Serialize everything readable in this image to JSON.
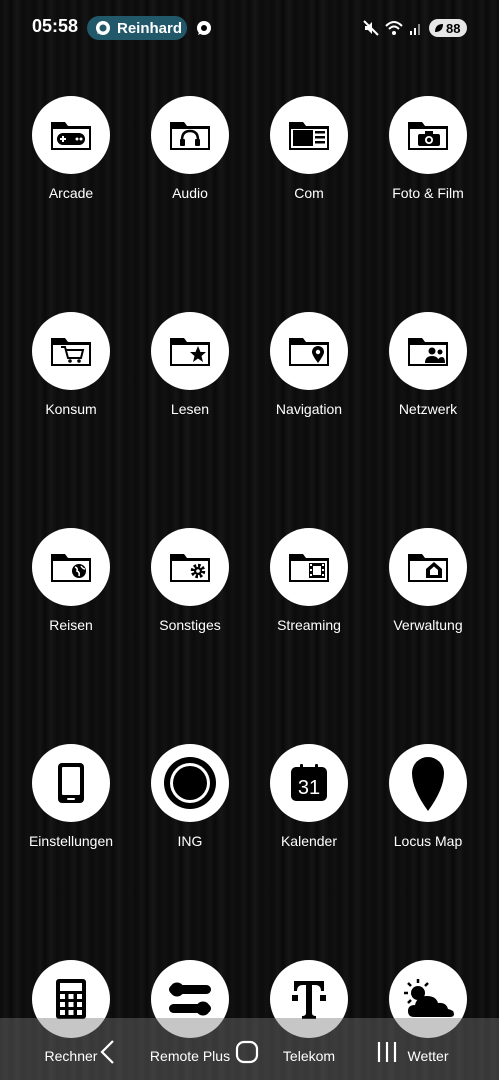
{
  "status_bar": {
    "time": "05:58",
    "chip_label": "Reinhard",
    "battery": "88",
    "icons": [
      "mute-icon",
      "wifi-icon",
      "signal-icon",
      "battery-icon"
    ]
  },
  "apps": [
    {
      "label": "Arcade",
      "icon": "folder-gamepad-icon"
    },
    {
      "label": "Audio",
      "icon": "folder-headphones-icon"
    },
    {
      "label": "Com",
      "icon": "folder-document-icon"
    },
    {
      "label": "Foto & Film",
      "icon": "folder-camera-icon"
    },
    {
      "label": "Konsum",
      "icon": "folder-cart-icon"
    },
    {
      "label": "Lesen",
      "icon": "folder-star-icon"
    },
    {
      "label": "Navigation",
      "icon": "folder-pin-icon"
    },
    {
      "label": "Netzwerk",
      "icon": "folder-people-icon"
    },
    {
      "label": "Reisen",
      "icon": "folder-globe-icon"
    },
    {
      "label": "Sonstiges",
      "icon": "folder-gear-icon"
    },
    {
      "label": "Streaming",
      "icon": "folder-film-icon"
    },
    {
      "label": "Verwaltung",
      "icon": "folder-home-icon"
    },
    {
      "label": "Einstellungen",
      "icon": "tablet-icon"
    },
    {
      "label": "ING",
      "icon": "ring-icon"
    },
    {
      "label": "Kalender",
      "icon": "calendar-icon",
      "day": "31"
    },
    {
      "label": "Locus Map",
      "icon": "map-pin-icon"
    },
    {
      "label": "Rechner",
      "icon": "calculator-icon"
    },
    {
      "label": "Remote Plus",
      "icon": "toggles-icon"
    },
    {
      "label": "Telekom",
      "icon": "telekom-t-icon"
    },
    {
      "label": "Wetter",
      "icon": "weather-icon"
    }
  ],
  "nav_bar": {
    "buttons": [
      "back-icon",
      "home-icon",
      "recents-icon"
    ]
  }
}
